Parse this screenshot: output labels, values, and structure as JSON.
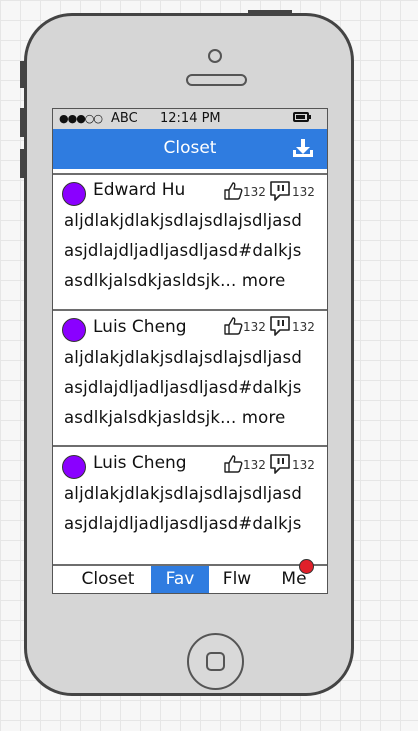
{
  "status_bar": {
    "signal": "●●●○○",
    "carrier": "ABC",
    "time": "12:14 PM"
  },
  "header": {
    "title": "Closet",
    "action_icon": "download-icon"
  },
  "posts": [
    {
      "author": "Edward Hu",
      "likes": "132",
      "comments": "132",
      "lines": [
        "aljdlakjdlakjsdlajsdlajsdljasd",
        "asjdlajdljadljasdljasd#dalkjs",
        "asdlkjalsdkjasldsjk..."
      ],
      "more_label": "more"
    },
    {
      "author": "Luis Cheng",
      "likes": "132",
      "comments": "132",
      "lines": [
        "aljdlakjdlakjsdlajsdlajsdljasd",
        "asjdlajdljadljasdljasd#dalkjs",
        "asdlkjalsdkjasldsjk..."
      ],
      "more_label": "more"
    },
    {
      "author": "Luis Cheng",
      "likes": "132",
      "comments": "132",
      "lines": [
        "aljdlakjdlakjsdlajsdlajsdljasd",
        "asjdlajdljadljasdljasd#dalkjs"
      ]
    }
  ],
  "tabs": [
    {
      "label": "Closet",
      "active": false
    },
    {
      "label": "Fav",
      "active": true
    },
    {
      "label": "Flw",
      "active": false
    },
    {
      "label": "Me",
      "active": false,
      "notification": true
    }
  ],
  "colors": {
    "accent": "#2f7ce0",
    "avatar": "#8a00ff",
    "badge": "#e0202a"
  }
}
